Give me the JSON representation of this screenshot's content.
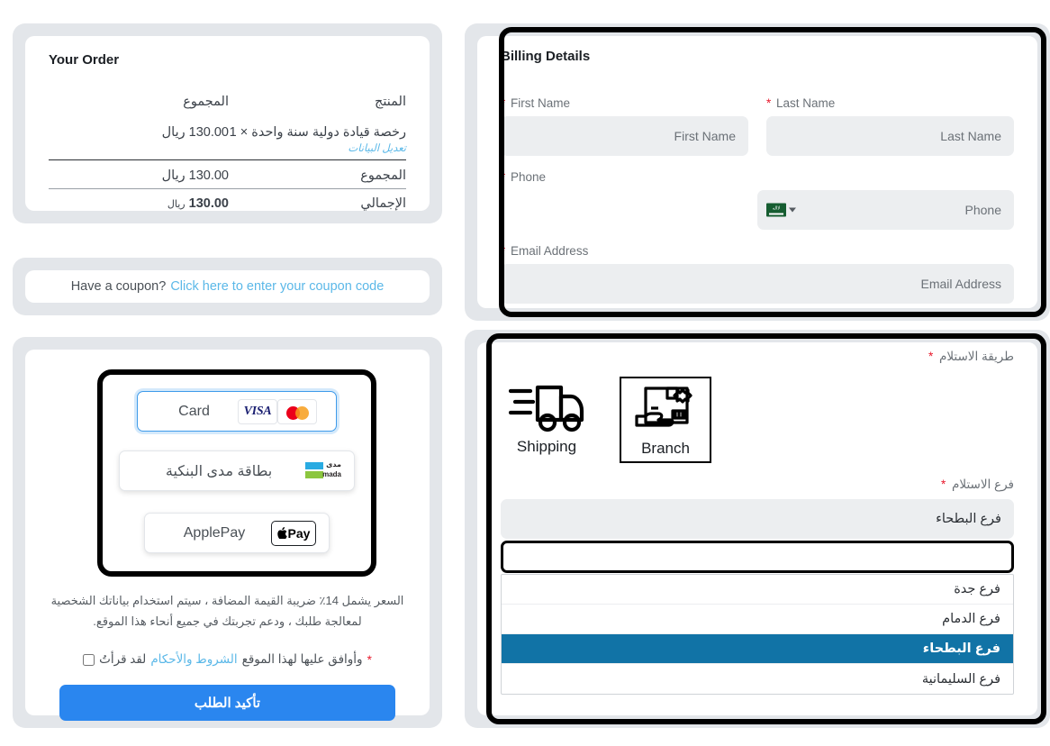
{
  "order": {
    "title": "Your Order",
    "col_product": "المنتج",
    "col_subtotal": "المجموع",
    "item_name": "رخصة قيادة دولية سنة واحدة × 1",
    "item_edit_link": "تعديل البيانات",
    "item_amount": "130.00 ريال",
    "subtotal_label": "المجموع",
    "subtotal_amount": "130.00 ريال",
    "total_label": "الإجمالي",
    "total_amount": "130.00",
    "total_currency": "ريال"
  },
  "coupon": {
    "prompt": "Have a coupon?",
    "link": "Click here to enter your coupon code"
  },
  "payment": {
    "options": [
      {
        "label": "Card",
        "logos": [
          "mastercard-logo",
          "visa-logo"
        ],
        "selected": true
      },
      {
        "label": "بطاقة مدى البنكية",
        "logos": [
          "mada-logo"
        ],
        "selected": false
      },
      {
        "label": "ApplePay",
        "logos": [
          "applepay-logo"
        ],
        "selected": false
      }
    ],
    "visa_text": "VISA",
    "mada_ar": "مدى",
    "mada_en": "mada",
    "applepay_text": "Pay",
    "tax_note": "السعر يشمل 14٪ ضريبة القيمة المضافة ، سيتم استخدام بياناتك الشخصية لمعالجة طلبك ، ودعم تجربتك في جميع أنحاء هذا الموقع.",
    "terms_prefix": "لقد قرأتُ",
    "terms_link": "الشروط والأحكام",
    "terms_suffix": "وأوافق عليها لهذا الموقع",
    "required_mark": "*",
    "confirm_button": "تأكيد الطلب",
    "accent_color": "#2a86ef"
  },
  "billing": {
    "title": "Billing Details",
    "required_mark": "*",
    "fields": [
      {
        "label": "First Name",
        "placeholder": "First Name",
        "value": ""
      },
      {
        "label": "Last Name",
        "placeholder": "Last Name",
        "value": ""
      },
      {
        "label": "Phone",
        "placeholder": "Phone",
        "value": "",
        "country_flag": "saudi-arabia-flag"
      },
      {
        "label": "Email Address",
        "placeholder": "Email Address",
        "value": ""
      }
    ]
  },
  "delivery": {
    "method_label": "طريقة الاستلام",
    "required_mark": "*",
    "methods": [
      {
        "name": "Shipping",
        "icon": "delivery-truck-icon",
        "selected": false
      },
      {
        "name": "Branch",
        "icon": "hand-package-icon",
        "selected": true
      }
    ],
    "branch_label": "فرع الاستلام",
    "selected_branch": "فرع البطحاء",
    "search_value": "",
    "options": [
      {
        "label": "فرع جدة",
        "highlighted": false
      },
      {
        "label": "فرع الدمام",
        "highlighted": false
      },
      {
        "label": "فرع البطحاء",
        "highlighted": true
      },
      {
        "label": "فرع السليمانية",
        "highlighted": false
      }
    ],
    "highlight_color": "#1173a6"
  }
}
